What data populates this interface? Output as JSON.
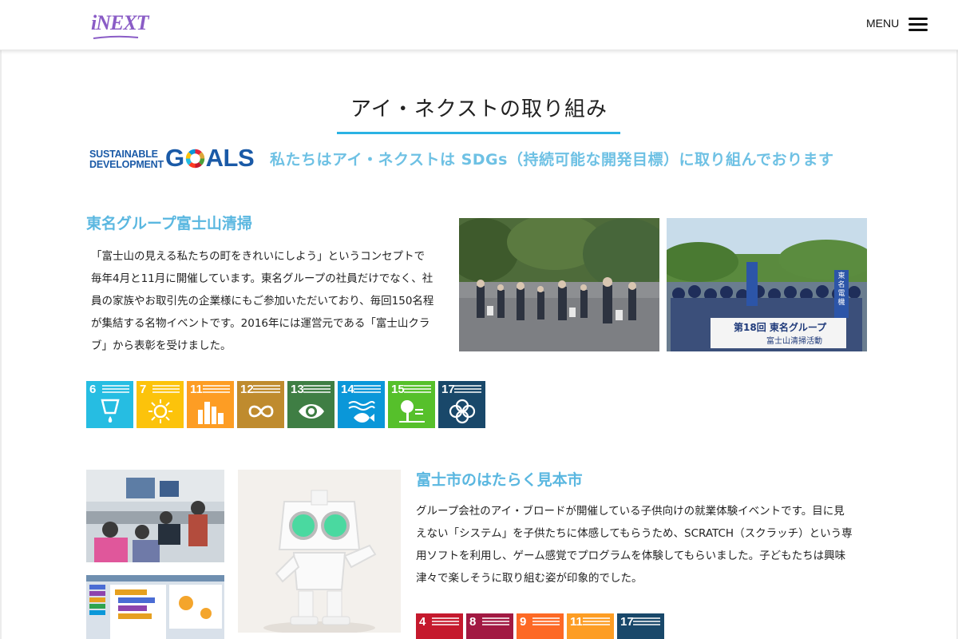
{
  "header": {
    "logo_text": "iNEXT",
    "menu_label": "MENU"
  },
  "page": {
    "title": "アイ・ネクストの取り組み"
  },
  "sdgs": {
    "logo_line1": "SUSTAINABLE",
    "logo_line2": "DEVELOPMENT",
    "logo_goals_left": "G",
    "logo_goals_right": "ALS",
    "tagline": "私たちはアイ・ネクストは SDGs（持続可能な開発目標）に取り組んでおります"
  },
  "section1": {
    "heading": "東名グループ富士山清掃",
    "lines": [
      "「富士山の見える私たちの町をきれいにしよう」というコンセプトで",
      "毎年4月と11月に開催しています。東名グループの社員だけでなく、社",
      "員の家族やお取引先の企業様にもご参加いただいており、毎回150名程",
      "が集結する名物イベントです。2016年には運営元である「富士山クラ",
      "ブ」から表彰を受けました。"
    ],
    "banner_text_1": "第18回 東名グループ",
    "banner_text_2": "富士山清掃活動",
    "flag_text": "東名電機",
    "goal_tiles": [
      {
        "num": "6",
        "color": "#26bde2",
        "icon": "water-icon"
      },
      {
        "num": "7",
        "color": "#fcc30b",
        "icon": "sun-icon"
      },
      {
        "num": "11",
        "color": "#fd9d24",
        "icon": "city-icon"
      },
      {
        "num": "12",
        "color": "#bf8b2e",
        "icon": "infinity-icon"
      },
      {
        "num": "13",
        "color": "#3f7e44",
        "icon": "eye-globe-icon"
      },
      {
        "num": "14",
        "color": "#0a97d9",
        "icon": "fish-icon"
      },
      {
        "num": "15",
        "color": "#56c02b",
        "icon": "tree-icon"
      },
      {
        "num": "17",
        "color": "#19486a",
        "icon": "flower-icon"
      }
    ]
  },
  "section2": {
    "heading": "富士市のはたらく見本市",
    "lines": [
      "グループ会社のアイ・ブロードが開催している子供向けの就業体験イベントです。目に見",
      "えない「システム」を子供たちに体感してもらうため、SCRATCH（スクラッチ）という専",
      "用ソフトを利用し、ゲーム感覚でプログラムを体験してもらいました。子どもたちは興味",
      "津々で楽しそうに取り組む姿が印象的でした。"
    ],
    "goal_tiles": [
      {
        "num": "4",
        "color": "#c5192d"
      },
      {
        "num": "8",
        "color": "#a21942"
      },
      {
        "num": "9",
        "color": "#fd6925"
      },
      {
        "num": "11",
        "color": "#fd9d24"
      },
      {
        "num": "17",
        "color": "#19486a"
      }
    ]
  }
}
